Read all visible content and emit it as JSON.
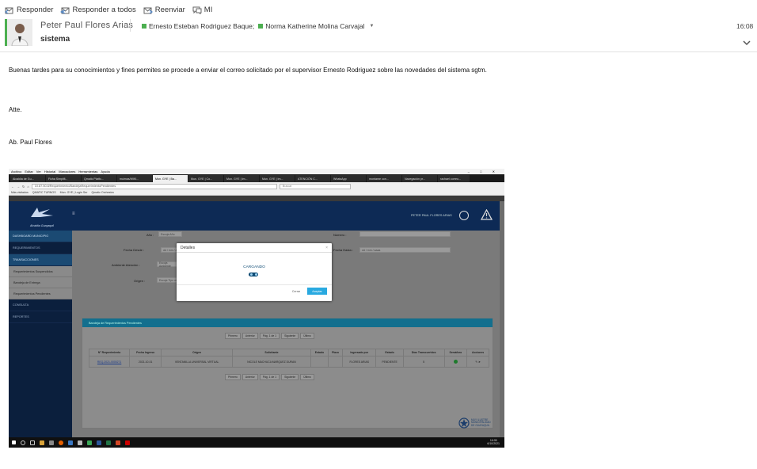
{
  "toolbar": {
    "reply": "Responder",
    "reply_all": "Responder a todos",
    "forward": "Reenviar",
    "im": "MI"
  },
  "email": {
    "sender": "Peter Paul Flores Arias",
    "recipients": [
      "Ernesto Esteban Rodriguez Baque;",
      "Norma Katherine Molina Carvajal"
    ],
    "time": "16:08",
    "subject": "sistema",
    "body": [
      "Buenas tardes para su conocimientos y fines permites se procede a enviar el correo solicitado por el supervisor Ernesto Rodriguez sobre las novedades del sistema sgtm.",
      "Atte.",
      "Ab. Paul Flores"
    ]
  },
  "screenshot": {
    "menu": [
      "Archivo",
      "Editar",
      "Ver",
      "Historial",
      "Marcadores",
      "Herramientas",
      "Ayuda"
    ],
    "tabs": [
      "Alcaldía de Gu...",
      "Ficha Simplifi...",
      "Qmatic Platfo...",
      "muimas/WIKI...",
      "Mun. GYE | Ba...",
      "Mun. GYE | Co...",
      "Mun. GYE | Im...",
      "Mun. GYE | Im...",
      "ATENCIÓN C...",
      "WhatsApp",
      "montame con...",
      "Navegación pr...",
      "rachael correo..."
    ],
    "url": "10.87.50.8/Requerimiento/BandejaRequerimientoPendientes",
    "search_placeholder": "Buscar",
    "bookmarks": [
      "Más visitados",
      "QMATIC TURNOS",
      "Mun. GYE | Login Ser",
      "Qmatic Orchestra"
    ],
    "user": "PETER PAUL FLORES ARIAS",
    "logo": "Alcaldía Guayaquil",
    "sidebar": [
      {
        "label": "DASHBOARD MUNICIPIO",
        "hl": true
      },
      {
        "label": "REQUERIMIENTOS",
        "hl": false
      },
      {
        "label": "TRANSACCIONES",
        "hl": true
      }
    ],
    "submenu": [
      "Requerimientos Suspendidos",
      "Bandeja de Entrega",
      "Requerimientos Pendientes"
    ],
    "sidebar_bottom": [
      "CONSULTA",
      "REPORTES"
    ],
    "form": {
      "anio_label": "Año :",
      "anio_value": "Escoja Año",
      "numero_label": "Número :",
      "fecha_desde_label": "Fecha Desde :",
      "fecha_desde_value": "dd / mm / aaaa",
      "fecha_hasta_label": "Fecha Hasta :",
      "fecha_hasta_value": "dd / mm / aaaa",
      "ambiente_label": "Ambiente Atención :",
      "ambiente_value": "Escoja Ambiente",
      "origen_label": "Origen :",
      "origen_value": "Escoja Tipo origen...",
      "search_button": "Buscar"
    },
    "panel_title": "Bandeja de Requerimientos Pendientes",
    "pager": [
      "Primero",
      "Anterior",
      "Pág. 1 de 1",
      "Siguiente",
      "Último"
    ],
    "table": {
      "headers": [
        "N° Requerimiento",
        "Fecha Ingreso",
        "Origen",
        "Solicitante",
        "Estado",
        "Plazo",
        "Ingresado por",
        "Estado",
        "Días Transcurridos",
        "Semáforo",
        "Acciones"
      ],
      "row": [
        "REQ-2021-0000271",
        "2021-10-01",
        "VENTANILLA UNIVERSAL VIRTUAL",
        "NICOLE MACHUCA MARQUEZ DURAN",
        "",
        "",
        "FLORES ARIAS",
        "PENDIENTE",
        "5",
        "",
        ""
      ]
    },
    "modal": {
      "title": "Detalles",
      "loading": "CARGANDO",
      "cancel": "Cerrar",
      "accept": "Aceptar"
    },
    "footer_logo": "MUY ILUSTRE MUNICIPALIDAD DE GUAYAQUIL",
    "clock": {
      "time": "16:05",
      "date": "6/10/2021"
    }
  },
  "colors": {
    "accent_green": "#4caf50",
    "app_header": "#0d2a55",
    "panel_teal": "#136f8e",
    "modal_accept": "#29a9e0"
  }
}
